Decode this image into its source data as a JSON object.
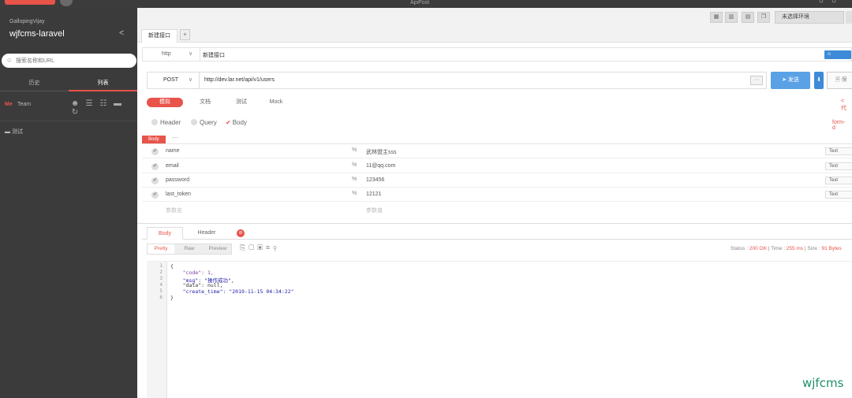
{
  "titlebar": {
    "title": "ApiPost"
  },
  "sidebar": {
    "user": "GallopingVijay",
    "project": "wjfcms-laravel",
    "search_placeholder": "搜索名称和URL",
    "tabs": [
      {
        "label": "历史"
      },
      {
        "label": "列表"
      }
    ],
    "team_me": "Me",
    "team_label": "Team",
    "folder": "测试"
  },
  "toolbar": {
    "env_select": "未选择环境"
  },
  "tabs": {
    "request_tab": "新建接口",
    "add": "+"
  },
  "request": {
    "protocol": "http",
    "name": "新建接口",
    "owner": "Gallopin",
    "method": "POST",
    "url": "http://dev.lar.net/api/v1/users",
    "more": "···",
    "send_label": "发送",
    "send_more": "⬇",
    "save_label": "保"
  },
  "subtabs": [
    {
      "label": "模拟"
    },
    {
      "label": "文档"
    },
    {
      "label": "测试"
    },
    {
      "label": "Mock"
    }
  ],
  "code_link": "< 代",
  "param_options": {
    "header": "Header",
    "query": "Query",
    "body": "Body",
    "form_data": "form-d"
  },
  "body_label": "Body",
  "body_sep": "···",
  "params": [
    {
      "key": "name",
      "value": "武林盟主sss",
      "type": "Text"
    },
    {
      "key": "email",
      "value": "11@qq.com",
      "type": "Text"
    },
    {
      "key": "password",
      "value": "123456",
      "type": "Text"
    },
    {
      "key": "last_token",
      "value": "12121",
      "type": "Text"
    }
  ],
  "param_placeholder": {
    "key": "参数名",
    "value": "参数值"
  },
  "response": {
    "tabs": [
      {
        "label": "Body"
      },
      {
        "label": "Header"
      }
    ],
    "formats": [
      {
        "label": "Pretty"
      },
      {
        "label": "Raw"
      },
      {
        "label": "Preview"
      }
    ],
    "status_label": "Status :",
    "status_value": "200 OK",
    "time_label": "Time :",
    "time_value": "255 ms",
    "size_label": "Size :",
    "size_value": "91 Bytes",
    "lines": [
      {
        "no": "1",
        "text": "{"
      },
      {
        "no": "2",
        "text": "    \"code\": 1,"
      },
      {
        "no": "3",
        "text": "    \"msg\": \"操作成功\","
      },
      {
        "no": "4",
        "text": "    \"data\": null,"
      },
      {
        "no": "5",
        "text": "    \"create_time\": \"2019-11-15 04:34:22\""
      },
      {
        "no": "6",
        "text": "}"
      }
    ]
  },
  "watermark": "wjfcms"
}
